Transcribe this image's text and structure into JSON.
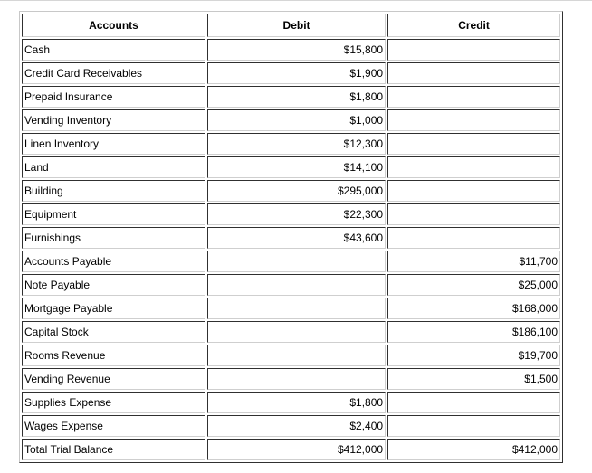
{
  "table": {
    "headers": [
      "Accounts",
      "Debit",
      "Credit"
    ],
    "rows": [
      {
        "account": "Cash",
        "debit": "$15,800",
        "credit": ""
      },
      {
        "account": "Credit Card Receivables",
        "debit": "$1,900",
        "credit": ""
      },
      {
        "account": "Prepaid Insurance",
        "debit": "$1,800",
        "credit": ""
      },
      {
        "account": "Vending Inventory",
        "debit": "$1,000",
        "credit": ""
      },
      {
        "account": "Linen Inventory",
        "debit": "$12,300",
        "credit": ""
      },
      {
        "account": "Land",
        "debit": "$14,100",
        "credit": ""
      },
      {
        "account": "Building",
        "debit": "$295,000",
        "credit": ""
      },
      {
        "account": "Equipment",
        "debit": "$22,300",
        "credit": ""
      },
      {
        "account": "Furnishings",
        "debit": "$43,600",
        "credit": ""
      },
      {
        "account": "Accounts Payable",
        "debit": "",
        "credit": "$11,700"
      },
      {
        "account": "Note Payable",
        "debit": "",
        "credit": "$25,000"
      },
      {
        "account": "Mortgage Payable",
        "debit": "",
        "credit": "$168,000"
      },
      {
        "account": "Capital Stock",
        "debit": "",
        "credit": "$186,100"
      },
      {
        "account": "Rooms Revenue",
        "debit": "",
        "credit": "$19,700"
      },
      {
        "account": "Vending Revenue",
        "debit": "",
        "credit": "$1,500"
      },
      {
        "account": "Supplies Expense",
        "debit": "$1,800",
        "credit": ""
      },
      {
        "account": "Wages Expense",
        "debit": "$2,400",
        "credit": ""
      },
      {
        "account": "Total Trial Balance",
        "debit": "$412,000",
        "credit": "$412,000"
      }
    ]
  }
}
